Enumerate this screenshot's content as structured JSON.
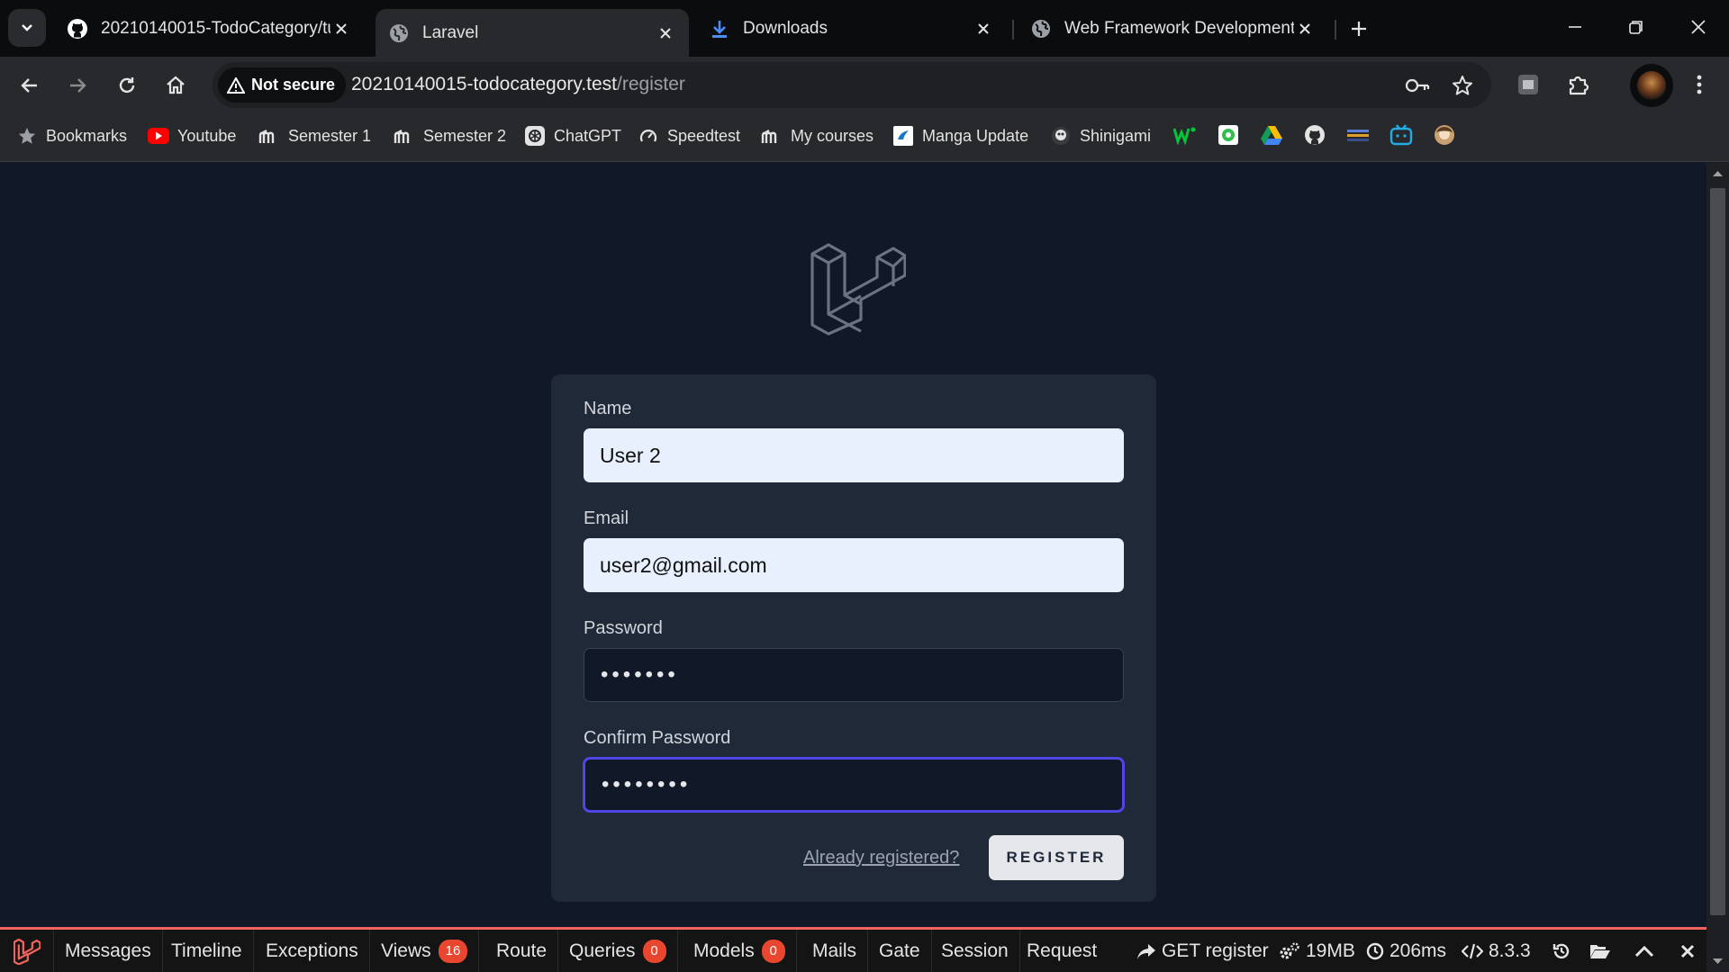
{
  "browser": {
    "tabs": [
      {
        "title": "20210140015-TodoCategory/tu",
        "icon": "github-icon",
        "active": false
      },
      {
        "title": "Laravel",
        "icon": "globe-icon",
        "active": true
      },
      {
        "title": "Downloads",
        "icon": "download-icon",
        "active": false
      },
      {
        "title": "Web Framework Development",
        "icon": "globe-icon",
        "active": false
      }
    ],
    "security_label": "Not secure",
    "url_host": "20210140015-todocategory.test",
    "url_path": "/register"
  },
  "bookmarks": {
    "items": [
      {
        "label": "Bookmarks",
        "icon": "star-icon"
      },
      {
        "label": "Youtube",
        "icon": "youtube-icon"
      },
      {
        "label": "Semester 1",
        "icon": "moodle-icon"
      },
      {
        "label": "Semester 2",
        "icon": "moodle-icon"
      },
      {
        "label": "ChatGPT",
        "icon": "chatgpt-icon"
      },
      {
        "label": "Speedtest",
        "icon": "speedtest-icon"
      },
      {
        "label": "My courses",
        "icon": "moodle-icon"
      },
      {
        "label": "Manga Update",
        "icon": "manga-update-icon"
      },
      {
        "label": "Shinigami",
        "icon": "shinigami-icon"
      }
    ]
  },
  "form": {
    "name_label": "Name",
    "name_value": "User 2",
    "email_label": "Email",
    "email_value": "user2@gmail.com",
    "password_label": "Password",
    "password_value": "•••••••",
    "confirm_label": "Confirm Password",
    "confirm_value": "••••••••",
    "login_link": "Already registered?",
    "register_button": "REGISTER"
  },
  "debugbar": {
    "tabs": [
      {
        "label": "Messages"
      },
      {
        "label": "Timeline"
      },
      {
        "label": "Exceptions"
      },
      {
        "label": "Views",
        "badge": "16"
      },
      {
        "label": "Route"
      },
      {
        "label": "Queries",
        "badge": "0"
      },
      {
        "label": "Models",
        "badge": "0"
      },
      {
        "label": "Mails"
      },
      {
        "label": "Gate"
      },
      {
        "label": "Session"
      },
      {
        "label": "Request"
      }
    ],
    "request": "GET register",
    "memory": "19MB",
    "time": "206ms",
    "php_version": "8.3.3"
  },
  "colors": {
    "page_bg": "#111827",
    "card_bg": "#1f2937",
    "focus_ring": "#4f46e5",
    "debugbar_accent": "#f4645f",
    "badge": "#e8462f"
  }
}
